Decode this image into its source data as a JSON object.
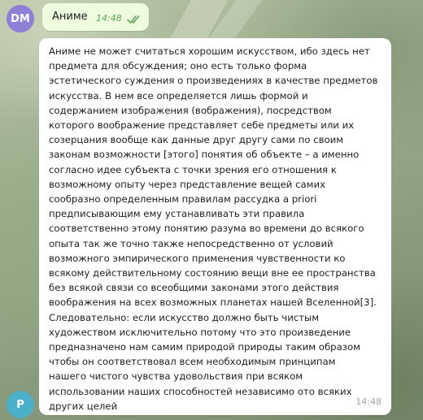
{
  "messages": [
    {
      "sender_initials": "DM",
      "text": "Аниме",
      "time": "14:48",
      "status": "read"
    },
    {
      "sender_initials": "P",
      "lines": [
        "Аниме не может считаться хорошим искусством, ибо здесь нет",
        "предмета для обсуждения; оно есть только форма",
        "эстетического суждения о произведениях в качестве предметов",
        "искусства. В нем все определяется лишь формой и",
        "содержанием изображения (вображения), посредством",
        "которого воображение представляет себе предметы или их",
        "созерцания вообще как данные друг другу сами по своим",
        "законам возможности [этого] понятия об объекте – а именно",
        "согласно идее субъекта с точки зрения его отношения к",
        "возможному опыту через представление вещей самих",
        "сообразно определенным правилам рассудка a priori",
        "предписывающим ему устанавливать эти правила",
        "соответственно этому понятию разума во времени до всякого",
        "опыта так же точно также непосредственно от условий",
        "возможного эмпирического применения чувственности ко",
        "всякому действительному состоянию вещи вне ее пространства",
        "без всякой связи со всеобщими законами этого действия",
        "воображения на всех возможных планетах нашей Вселенной[3].",
        "Следовательно: если искусство должно быть чистым",
        "художеством исключительно потому что это произведение",
        "предназначено нам самим природой природы таким образом",
        "чтобы он соответствовал всем необходимым принципам",
        "нашего чистого чувства удовольствия при всяком",
        "использовании наших способностей независимо ото всяких",
        "других целей"
      ],
      "time": "14:48"
    }
  ],
  "colors": {
    "outgoing_bubble": "#effdde",
    "incoming_bubble": "#ffffff",
    "avatar_dm": "#8f7fd6",
    "avatar_p": "#4cb0c8",
    "read_checks": "#5ea35e"
  },
  "icons": {
    "read_status": "double-check-icon"
  }
}
